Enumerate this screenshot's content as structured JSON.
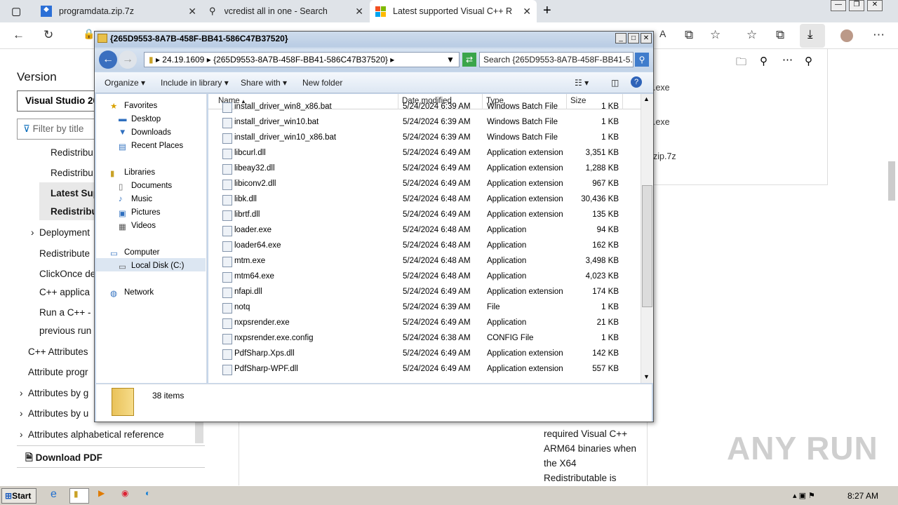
{
  "browser": {
    "tabs": [
      {
        "label": "programdata.zip.7z"
      },
      {
        "label": "vcredist all in one - Search"
      },
      {
        "label": "Latest supported Visual C++ Red"
      }
    ]
  },
  "page": {
    "heading": "Version",
    "version_select": "Visual Studio 20",
    "filter_placeholder": "Filter by title",
    "nav": [
      "Redistribu",
      "Redistribu",
      "Latest Sup",
      "Redistribu",
      "Deployment",
      "Redistribute",
      "ClickOnce de",
      "C++ applica",
      "Run a C++ -",
      "previous run",
      "C++ Attributes",
      "Attribute progr",
      "Attributes by g",
      "Attributes by u",
      "Attributes alphabetical reference"
    ],
    "download_pdf": "Download PDF",
    "body_text": [
      "required Visual C++",
      "ARM64 binaries when",
      "the X64",
      "Redistributable is"
    ],
    "downloads": [
      ".exe",
      ".exe",
      "zip.7z"
    ],
    "watermark": "ANY RUN"
  },
  "explorer": {
    "title": "{265D9553-8A7B-458F-BB41-586C47B37520}",
    "breadcrumb": [
      "24.19.1609",
      "{265D9553-8A7B-458F-BB41-586C47B37520}"
    ],
    "search_placeholder": "Search {265D9553-8A7B-458F-BB41-5...",
    "toolbar": {
      "organize": "Organize",
      "include": "Include in library",
      "share": "Share with",
      "new_folder": "New folder"
    },
    "nav": {
      "favorites": "Favorites",
      "desktop": "Desktop",
      "downloads": "Downloads",
      "recent": "Recent Places",
      "libraries": "Libraries",
      "documents": "Documents",
      "music": "Music",
      "pictures": "Pictures",
      "videos": "Videos",
      "computer": "Computer",
      "local_disk": "Local Disk (C:)",
      "network": "Network"
    },
    "columns": {
      "name": "Name",
      "date": "Date modified",
      "type": "Type",
      "size": "Size"
    },
    "files": [
      {
        "name": "install_driver_win8_x86.bat",
        "date": "5/24/2024 6:39 AM",
        "type": "Windows Batch File",
        "size": "1 KB"
      },
      {
        "name": "install_driver_win10.bat",
        "date": "5/24/2024 6:39 AM",
        "type": "Windows Batch File",
        "size": "1 KB"
      },
      {
        "name": "install_driver_win10_x86.bat",
        "date": "5/24/2024 6:39 AM",
        "type": "Windows Batch File",
        "size": "1 KB"
      },
      {
        "name": "libcurl.dll",
        "date": "5/24/2024 6:49 AM",
        "type": "Application extension",
        "size": "3,351 KB"
      },
      {
        "name": "libeay32.dll",
        "date": "5/24/2024 6:49 AM",
        "type": "Application extension",
        "size": "1,288 KB"
      },
      {
        "name": "libiconv2.dll",
        "date": "5/24/2024 6:49 AM",
        "type": "Application extension",
        "size": "967 KB"
      },
      {
        "name": "libk.dll",
        "date": "5/24/2024 6:48 AM",
        "type": "Application extension",
        "size": "30,436 KB"
      },
      {
        "name": "librtf.dll",
        "date": "5/24/2024 6:49 AM",
        "type": "Application extension",
        "size": "135 KB"
      },
      {
        "name": "loader.exe",
        "date": "5/24/2024 6:48 AM",
        "type": "Application",
        "size": "94 KB"
      },
      {
        "name": "loader64.exe",
        "date": "5/24/2024 6:48 AM",
        "type": "Application",
        "size": "162 KB"
      },
      {
        "name": "mtm.exe",
        "date": "5/24/2024 6:48 AM",
        "type": "Application",
        "size": "3,498 KB"
      },
      {
        "name": "mtm64.exe",
        "date": "5/24/2024 6:48 AM",
        "type": "Application",
        "size": "4,023 KB"
      },
      {
        "name": "nfapi.dll",
        "date": "5/24/2024 6:49 AM",
        "type": "Application extension",
        "size": "174 KB"
      },
      {
        "name": "notq",
        "date": "5/24/2024 6:39 AM",
        "type": "File",
        "size": "1 KB"
      },
      {
        "name": "nxpsrender.exe",
        "date": "5/24/2024 6:49 AM",
        "type": "Application",
        "size": "21 KB"
      },
      {
        "name": "nxpsrender.exe.config",
        "date": "5/24/2024 6:38 AM",
        "type": "CONFIG File",
        "size": "1 KB"
      },
      {
        "name": "PdfSharp.Xps.dll",
        "date": "5/24/2024 6:49 AM",
        "type": "Application extension",
        "size": "142 KB"
      },
      {
        "name": "PdfSharp-WPF.dll",
        "date": "5/24/2024 6:49 AM",
        "type": "Application extension",
        "size": "557 KB"
      }
    ],
    "status": "38 items"
  },
  "taskbar": {
    "start": "Start",
    "clock": "8:27 AM"
  }
}
